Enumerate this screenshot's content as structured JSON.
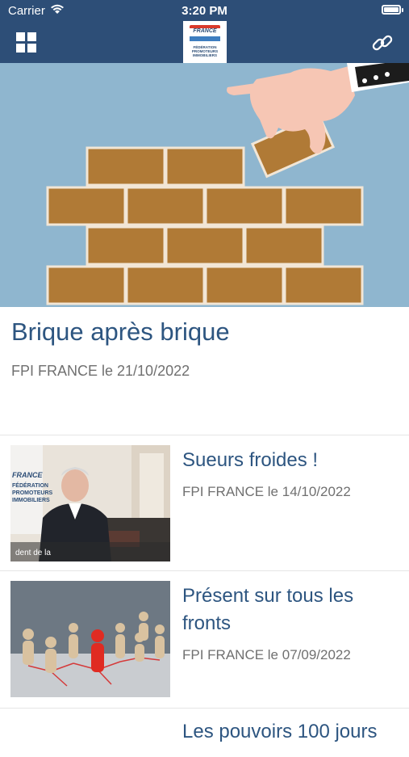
{
  "status_bar": {
    "carrier": "Carrier",
    "time": "3:20 PM"
  },
  "nav": {
    "logo_brand": "FRANCE",
    "logo_text": "FÉDÉRATION PROMOTEURS IMMOBILIERS",
    "menu_icon": "grid-icon",
    "link_icon": "link-icon"
  },
  "featured": {
    "title": "Brique après brique",
    "meta": "FPI FRANCE le 21/10/2022"
  },
  "articles": [
    {
      "title": "Sueurs froides !",
      "meta": "FPI FRANCE le 14/10/2022"
    },
    {
      "title": "Présent sur tous les fronts",
      "meta": "FPI FRANCE le 07/09/2022"
    },
    {
      "title": "Les pouvoirs 100 jours",
      "meta": ""
    }
  ],
  "thumb1_caption": "dent de la",
  "thumb1_logo": {
    "brand": "FRANCE",
    "text": "FÉDÉRATION PROMOTEURS IMMOBILIERS"
  },
  "colors": {
    "navbar": "#2d4e77",
    "title": "#2d5580",
    "meta": "#707070",
    "hero_bg": "#8fb6cf",
    "brick": "#b07a36"
  }
}
